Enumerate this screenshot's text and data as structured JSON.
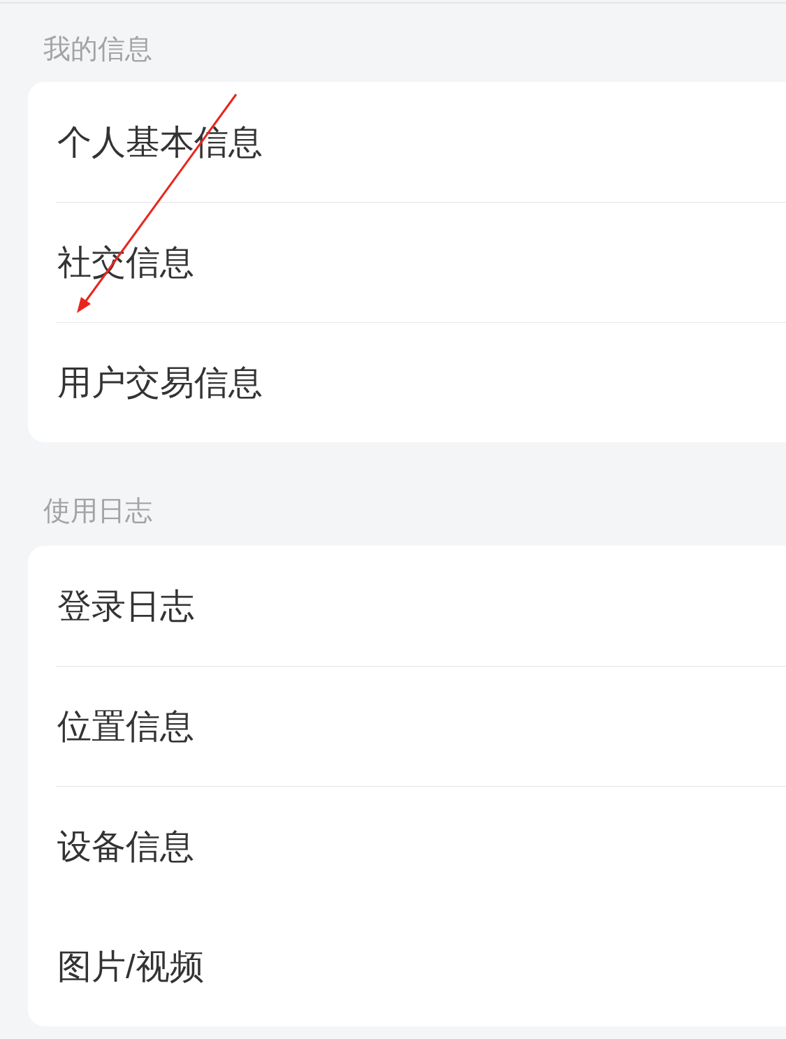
{
  "sections": [
    {
      "title": "我的信息",
      "items": [
        {
          "label": "个人基本信息",
          "divider_above": false
        },
        {
          "label": "社交信息",
          "divider_above": true
        },
        {
          "label": "用户交易信息",
          "divider_above": true
        }
      ]
    },
    {
      "title": "使用日志",
      "items": [
        {
          "label": "登录日志",
          "divider_above": false
        },
        {
          "label": "位置信息",
          "divider_above": true
        },
        {
          "label": "设备信息",
          "divider_above": true
        },
        {
          "label": "图片/视频",
          "divider_above": false
        }
      ]
    }
  ],
  "annotations": [
    {
      "kind": "arrow"
    }
  ]
}
